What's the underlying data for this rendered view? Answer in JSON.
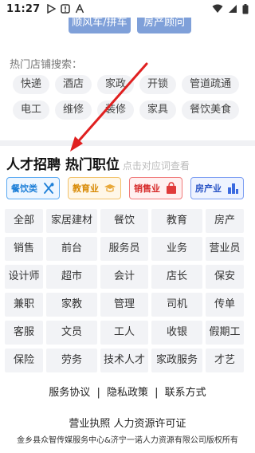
{
  "status_bar": {
    "time": "11:27",
    "icons": [
      "play-store-icon",
      "warning-icon",
      "a-icon",
      "wifi-icon",
      "cellular-icon",
      "battery-icon"
    ]
  },
  "top_tags": [
    "顺风车/拼车",
    "房产顾问"
  ],
  "hot_shops": {
    "title": "热门店铺搜索：",
    "rows": [
      [
        "快递",
        "酒店",
        "家政",
        "开锁",
        "管道疏通"
      ],
      [
        "电工",
        "维修",
        "装修",
        "家具",
        "餐饮美食"
      ]
    ]
  },
  "section": {
    "title": "人才招聘 热门职位",
    "subtitle": "点击对应词查看"
  },
  "categories": [
    {
      "label": "餐饮类",
      "icon": "utensils-icon",
      "color": "#1d7fd8"
    },
    {
      "label": "教育业",
      "icon": "graduation-cap-icon",
      "color": "#d88a05"
    },
    {
      "label": "销售业",
      "icon": "shopping-bag-icon",
      "color": "#d62a2a"
    },
    {
      "label": "房产业",
      "icon": "buildings-icon",
      "color": "#2a55c6"
    }
  ],
  "jobs": [
    [
      "全部",
      "家居建材",
      "餐饮",
      "教育",
      "房产"
    ],
    [
      "销售",
      "前台",
      "服务员",
      "业务",
      "营业员"
    ],
    [
      "设计师",
      "超市",
      "会计",
      "店长",
      "保安"
    ],
    [
      "兼职",
      "家教",
      "管理",
      "司机",
      "传单"
    ],
    [
      "客服",
      "文员",
      "工人",
      "收银",
      "假期工"
    ],
    [
      "保险",
      "劳务",
      "技术人才",
      "家政服务",
      "才艺"
    ]
  ],
  "footer": {
    "service": "服务协议",
    "sep": "|",
    "privacy": "隐私政策",
    "contact": "联系方式",
    "license": "营业执照 人力资源许可证",
    "copyright": "金乡县众智传媒服务中心&济宁一诺人力资源有限公司版权所有"
  }
}
